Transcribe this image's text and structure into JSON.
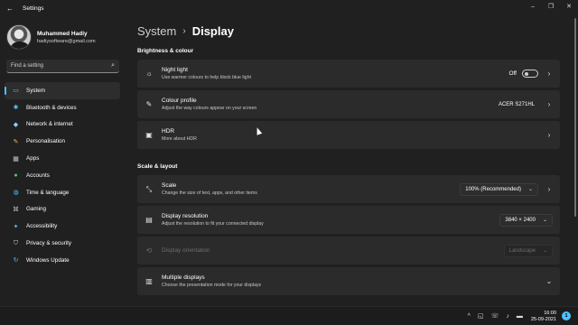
{
  "app": {
    "title": "Settings",
    "back_icon": "←",
    "controls": {
      "minimize": "–",
      "maximize": "❐",
      "close": "✕"
    }
  },
  "profile": {
    "name": "Muhammed Hadiy",
    "email": "hadiysoftware@gmail.com"
  },
  "search": {
    "placeholder": "Find a setting",
    "icon": "⌕"
  },
  "nav": [
    {
      "label": "System",
      "icon": "▭",
      "color": "#4cc2ff",
      "active": true
    },
    {
      "label": "Bluetooth & devices",
      "icon": "✱",
      "color": "#4cc2ff"
    },
    {
      "label": "Network & internet",
      "icon": "◆",
      "color": "#8fd0ff"
    },
    {
      "label": "Personalisation",
      "icon": "✎",
      "color": "#f7a95c"
    },
    {
      "label": "Apps",
      "icon": "▦",
      "color": "#c7c7c7"
    },
    {
      "label": "Accounts",
      "icon": "●",
      "color": "#5fc46a"
    },
    {
      "label": "Time & language",
      "icon": "◍",
      "color": "#4cc2ff"
    },
    {
      "label": "Gaming",
      "icon": "⌘",
      "color": "#c7c7c7"
    },
    {
      "label": "Accessibility",
      "icon": "✦",
      "color": "#4cc2ff"
    },
    {
      "label": "Privacy & security",
      "icon": "⛉",
      "color": "#c7c7c7"
    },
    {
      "label": "Windows Update",
      "icon": "↻",
      "color": "#4cc2ff"
    }
  ],
  "breadcrumb": {
    "parent": "System",
    "separator": "›",
    "current": "Display"
  },
  "sections": {
    "brightness": "Brightness & colour",
    "scale_layout": "Scale & layout"
  },
  "cards": {
    "night_light": {
      "title": "Night light",
      "desc": "Use warmer colours to help block blue light",
      "toggle_label": "Off",
      "icon": "☼"
    },
    "colour_profile": {
      "title": "Colour profile",
      "desc": "Adjust the way colours appear on your screen",
      "value": "ACER S271HL",
      "icon": "✎"
    },
    "hdr": {
      "title": "HDR",
      "desc": "More about HDR",
      "icon": "▣"
    },
    "scale": {
      "title": "Scale",
      "desc": "Change the size of text, apps, and other items",
      "value": "100% (Recommended)",
      "icon": "⤡"
    },
    "display_resolution": {
      "title": "Display resolution",
      "desc": "Adjust the resolution to fit your connected display",
      "value": "3840 × 2400",
      "icon": "▤"
    },
    "display_orientation": {
      "title": "Display orientation",
      "value": "Landscape",
      "icon": "⟲"
    },
    "multiple_displays": {
      "title": "Multiple displays",
      "desc": "Choose the presentation mode for your displays",
      "icon": "▥"
    }
  },
  "taskbar": {
    "icons": [
      "^",
      "◱",
      "☏",
      "♪",
      "▬"
    ],
    "time": "16:00",
    "date": "25-09-2021",
    "notifications": "1"
  }
}
